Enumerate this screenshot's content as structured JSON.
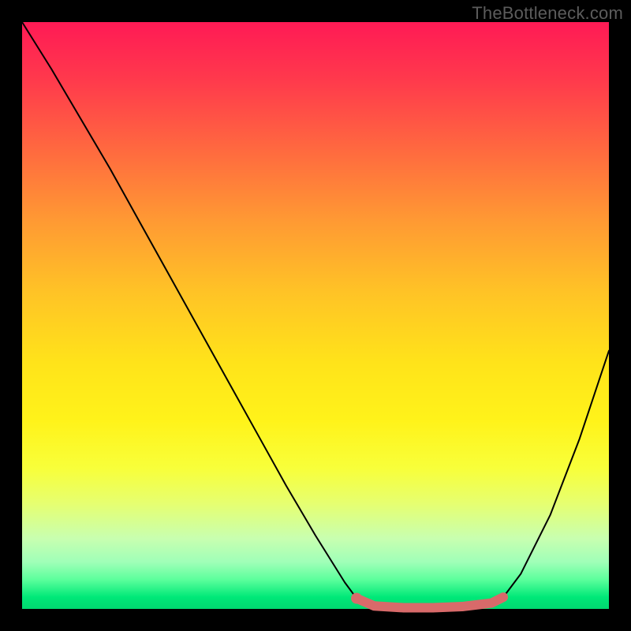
{
  "watermark": "TheBottleneck.com",
  "colors": {
    "curve": "#000000",
    "highlight": "#d86a6a",
    "gradient_top": "#ff1a55",
    "gradient_bottom": "#00d870"
  },
  "chart_data": {
    "type": "line",
    "title": "",
    "xlabel": "",
    "ylabel": "",
    "xlim": [
      0,
      100
    ],
    "ylim": [
      0,
      100
    ],
    "x": [
      0,
      5,
      10,
      15,
      20,
      25,
      30,
      35,
      40,
      45,
      50,
      55,
      57,
      60,
      65,
      70,
      75,
      80,
      82,
      85,
      90,
      95,
      100
    ],
    "values": [
      100,
      92,
      83.5,
      75,
      66,
      57,
      48,
      39,
      30,
      21,
      12.5,
      4.5,
      1.8,
      0.5,
      0.2,
      0.2,
      0.4,
      1.0,
      2.0,
      6,
      16,
      29,
      44
    ],
    "highlight": {
      "x": [
        57,
        60,
        65,
        70,
        75,
        80,
        82
      ],
      "values": [
        1.8,
        0.5,
        0.2,
        0.2,
        0.4,
        1.0,
        2.0
      ],
      "start_dot": {
        "x": 57,
        "y": 1.8
      }
    },
    "annotations": []
  }
}
